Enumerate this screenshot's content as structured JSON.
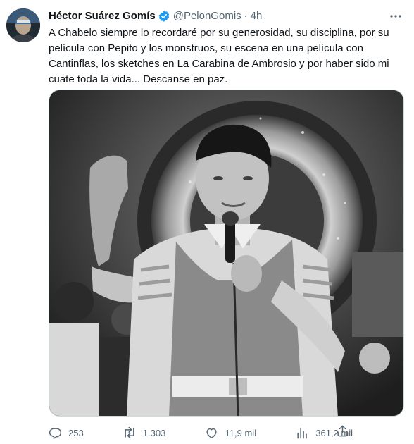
{
  "author": {
    "display_name": "Héctor Suárez Gomís",
    "handle": "@PelonGomis",
    "separator": "·",
    "time": "4h"
  },
  "text_lines": [
    "A Chabelo siempre lo recordaré por su generosidad, su disciplina, por su",
    "película con Pepito y los monstruos, su escena en una película con",
    "Cantinflas, los sketches en La Carabina de Ambrosio y por haber sido mi",
    "cuate toda la vida... Descanse en paz."
  ],
  "actions": {
    "replies": "253",
    "retweets": "1.303",
    "likes": "11,9 mil",
    "views": "361,2 mil"
  },
  "colors": {
    "text": "#0f1419",
    "secondary": "#536471",
    "verified": "#1d9bf0",
    "border": "#cfd9de"
  },
  "icons": [
    "avatar",
    "verified-badge-icon",
    "more-icon",
    "reply-icon",
    "retweet-icon",
    "like-icon",
    "views-icon",
    "share-icon"
  ]
}
